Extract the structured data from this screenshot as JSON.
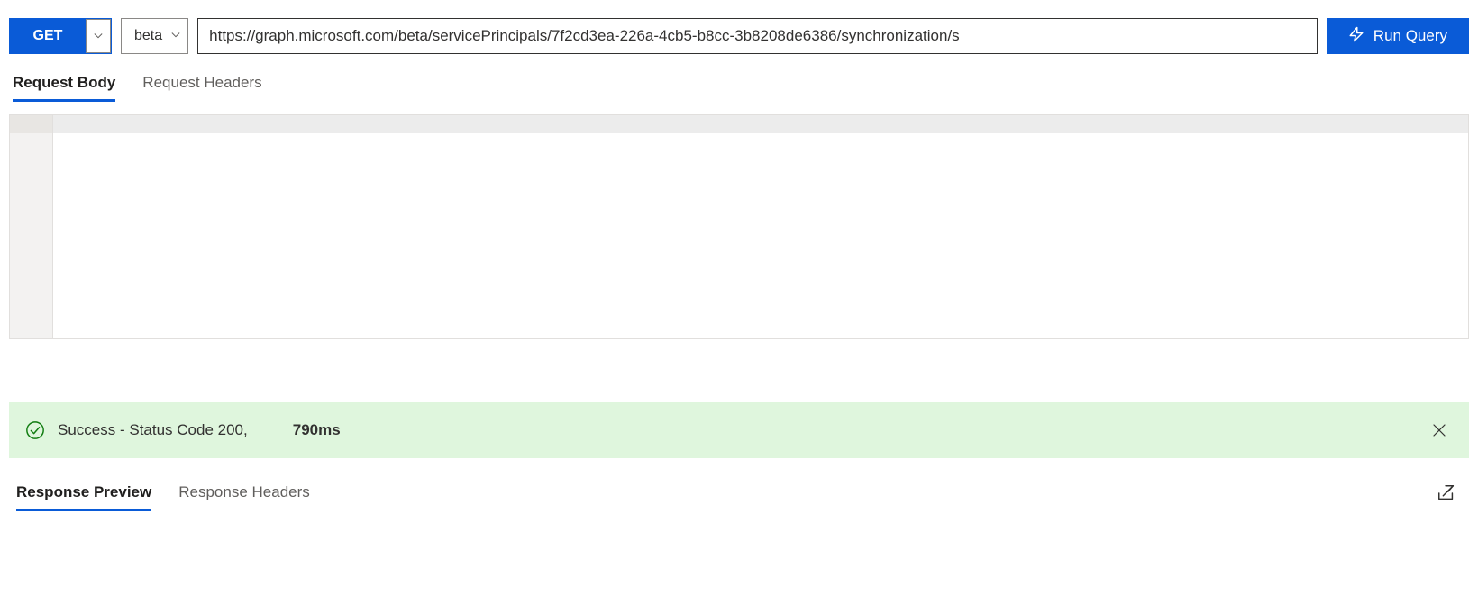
{
  "queryBar": {
    "method": "GET",
    "version": "beta",
    "url": "https://graph.microsoft.com/beta/servicePrincipals/7f2cd3ea-226a-4cb5-b8cc-3b8208de6386/synchronization/s",
    "run_label": "Run Query"
  },
  "requestTabs": {
    "body": "Request Body",
    "headers": "Request Headers"
  },
  "status": {
    "text": "Success - Status Code 200,",
    "time": "790ms"
  },
  "responseTabs": {
    "preview": "Response Preview",
    "headers": "Response Headers"
  }
}
